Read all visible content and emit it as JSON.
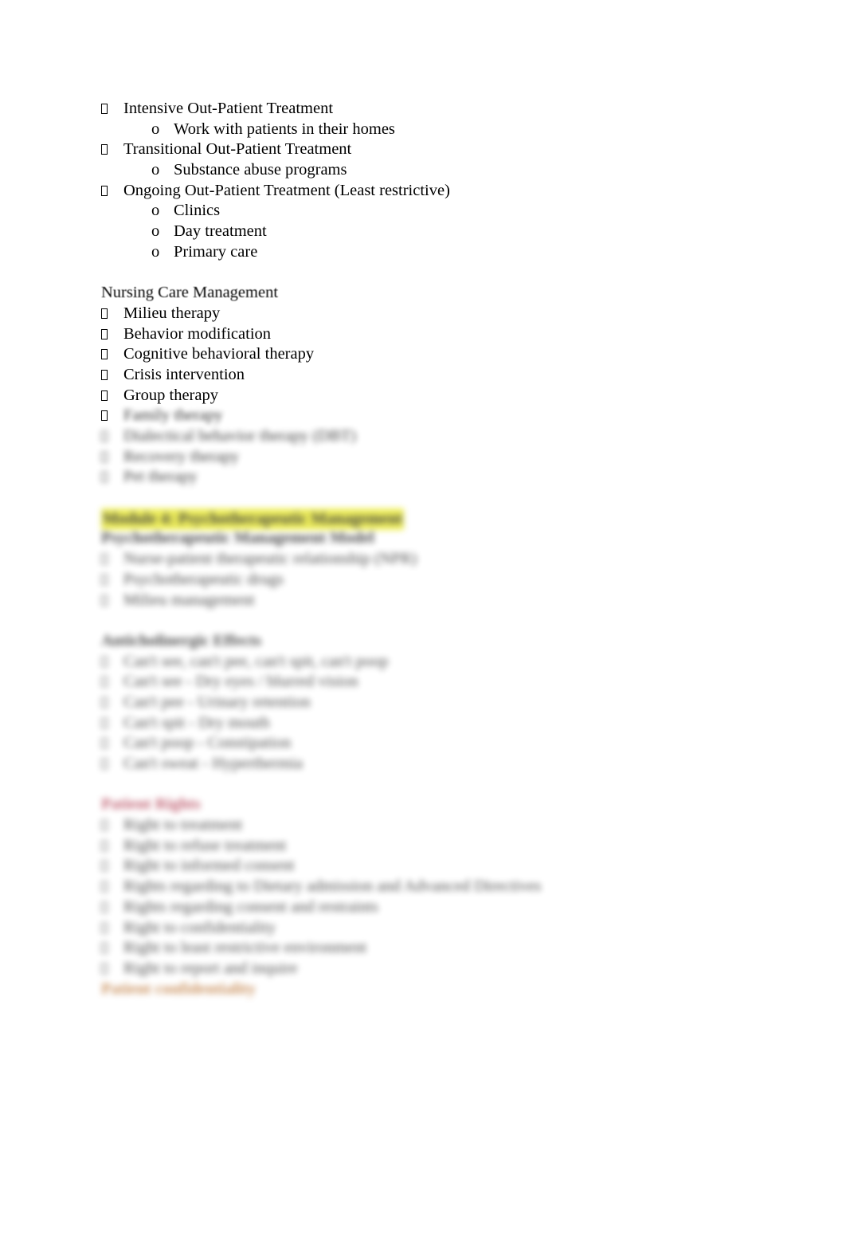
{
  "document": {
    "page_background": "#ffffff",
    "text_color": "#000000",
    "highlight_color": "#e8e81a",
    "accent_red": "#a8243c",
    "accent_orange": "#b5651d",
    "bullet_glyph": "missing-glyph-box",
    "sub_bullet_glyph": "o"
  },
  "blocks": [
    {
      "id": "levels-of-care",
      "items": [
        {
          "level": 1,
          "text": "Intensive Out-Patient Treatment",
          "blur": 0
        },
        {
          "level": 2,
          "text": "Work with patients in their homes",
          "blur": 0
        },
        {
          "level": 1,
          "text": "Transitional Out-Patient Treatment",
          "blur": 0
        },
        {
          "level": 2,
          "text": "Substance abuse programs",
          "blur": 0
        },
        {
          "level": 1,
          "text": "Ongoing Out-Patient Treatment (Least restrictive)",
          "blur": 0
        },
        {
          "level": 2,
          "text": "Clinics",
          "blur": 0
        },
        {
          "level": 2,
          "text": "Day treatment",
          "blur": 0
        },
        {
          "level": 2,
          "text": "Primary care",
          "blur": 0
        }
      ]
    },
    {
      "id": "nursing-care-management",
      "heading": "Nursing Care Management",
      "heading_blur": 1,
      "items": [
        {
          "level": 1,
          "text": "Milieu therapy",
          "blur": 0
        },
        {
          "level": 1,
          "text": "Behavior modification",
          "blur": 0
        },
        {
          "level": 1,
          "text": "Cognitive behavioral therapy",
          "blur": 0
        },
        {
          "level": 1,
          "text": "Crisis intervention",
          "blur": 0
        },
        {
          "level": 1,
          "text": "Group therapy",
          "blur": 0
        },
        {
          "level": 1,
          "text": "Family therapy",
          "blur": 4
        },
        {
          "level": 1,
          "text": "Dialectical behavior therapy (DBT)",
          "blur": 5
        },
        {
          "level": 1,
          "text": "Recovery therapy",
          "blur": 5
        },
        {
          "level": 1,
          "text": "Pet therapy",
          "blur": 5
        }
      ]
    },
    {
      "id": "module-psychotherapeutic-management",
      "heading": "Module 4: Psychotherapeutic Management",
      "heading_highlighted": true,
      "heading_blur": 6,
      "subheading": "Psychotherapeutic Management Model",
      "subheading_blur": 6,
      "items": [
        {
          "level": 1,
          "text": "Nurse-patient therapeutic relationship (NPR)",
          "blur": 6
        },
        {
          "level": 1,
          "text": "Psychotherapeutic drugs",
          "blur": 6
        },
        {
          "level": 1,
          "text": "Milieu management",
          "blur": 6
        }
      ]
    },
    {
      "id": "anticholinergic-effects",
      "heading": "Anticholinergic Effects",
      "heading_blur": 7,
      "items": [
        {
          "level": 1,
          "text": "Can't see, can't pee, can't spit, can't poop",
          "blur": 7
        },
        {
          "level": 1,
          "text": "Can't see  -  Dry eyes / blurred vision",
          "blur": 7
        },
        {
          "level": 1,
          "text": "Can't pee  -  Urinary retention",
          "blur": 7
        },
        {
          "level": 1,
          "text": "Can't spit  -  Dry mouth",
          "blur": 7
        },
        {
          "level": 1,
          "text": "Can't poop  -  Constipation",
          "blur": 7
        },
        {
          "level": 1,
          "text": "Can't sweat  -  Hyperthermia",
          "blur": 7
        }
      ]
    },
    {
      "id": "patient-rights",
      "heading": "Patient Rights",
      "heading_blur": 7,
      "heading_accent": "#a8243c",
      "items": [
        {
          "level": 1,
          "text": "Right to treatment",
          "blur": 7
        },
        {
          "level": 1,
          "text": "Right to refuse treatment",
          "blur": 7
        },
        {
          "level": 1,
          "text": "Right to informed consent",
          "blur": 7
        },
        {
          "level": 1,
          "text": "Rights regarding to Dietary admission and Advanced Directives",
          "blur": 7
        },
        {
          "level": 1,
          "text": "Rights regarding consent and restraints",
          "blur": 7
        },
        {
          "level": 1,
          "text": "Right to confidentiality",
          "blur": 7
        },
        {
          "level": 1,
          "text": "Right to least restrictive environment",
          "blur": 7
        },
        {
          "level": 1,
          "text": "Right to report and inquire",
          "blur": 7
        }
      ],
      "footer": "Patient confidentiality",
      "footer_blur": 7,
      "footer_accent": "#b5651d"
    }
  ]
}
